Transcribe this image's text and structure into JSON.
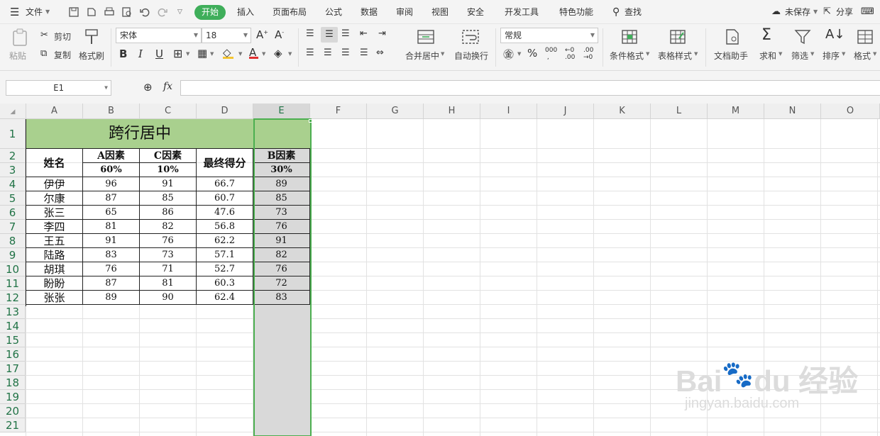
{
  "menubar": {
    "file": "文件",
    "tabs": [
      "开始",
      "插入",
      "页面布局",
      "公式",
      "数据",
      "审阅",
      "视图",
      "安全",
      "开发工具",
      "特色功能"
    ],
    "search": "查找",
    "unsaved": "未保存",
    "share": "分享"
  },
  "ribbon": {
    "paste": "粘贴",
    "cut": "剪切",
    "copy": "复制",
    "format_painter": "格式刷",
    "font_name": "宋体",
    "font_size": "18",
    "bold": "B",
    "italic": "I",
    "underline": "U",
    "merge_center": "合并居中",
    "wrap_text": "自动换行",
    "number_format": "常规",
    "percent": "%",
    "thousands": "000",
    "cond_format": "条件格式",
    "table_style": "表格样式",
    "doc_helper": "文档助手",
    "sum": "求和",
    "filter": "筛选",
    "sort": "排序",
    "format": "格式"
  },
  "formula_bar": {
    "cell_ref": "E1",
    "fx": "fx",
    "value": ""
  },
  "sheet": {
    "columns": [
      "A",
      "B",
      "C",
      "D",
      "E",
      "F",
      "G",
      "H",
      "I",
      "J",
      "K",
      "L",
      "M",
      "N",
      "O"
    ],
    "rows": [
      "1",
      "2",
      "3",
      "4",
      "5",
      "6",
      "7",
      "8",
      "9",
      "10",
      "11",
      "12",
      "13",
      "14",
      "15",
      "16",
      "17",
      "18",
      "19",
      "20",
      "21"
    ],
    "selected_column": "E",
    "title": "跨行居中",
    "header": {
      "name": "姓名",
      "a_factor": "A因素",
      "a_weight": "60%",
      "c_factor": "C因素",
      "c_weight": "10%",
      "final": "最终得分",
      "b_factor": "B因素",
      "b_weight": "30%"
    },
    "data": [
      {
        "name": "伊伊",
        "a": "96",
        "c": "91",
        "final": "66.7",
        "b": "89"
      },
      {
        "name": "尔康",
        "a": "87",
        "c": "85",
        "final": "60.7",
        "b": "85"
      },
      {
        "name": "张三",
        "a": "65",
        "c": "86",
        "final": "47.6",
        "b": "73"
      },
      {
        "name": "李四",
        "a": "81",
        "c": "82",
        "final": "56.8",
        "b": "76"
      },
      {
        "name": "王五",
        "a": "91",
        "c": "76",
        "final": "62.2",
        "b": "91"
      },
      {
        "name": "陆路",
        "a": "83",
        "c": "73",
        "final": "57.1",
        "b": "82"
      },
      {
        "name": "胡琪",
        "a": "76",
        "c": "71",
        "final": "52.7",
        "b": "76"
      },
      {
        "name": "盼盼",
        "a": "87",
        "c": "81",
        "final": "60.3",
        "b": "72"
      },
      {
        "name": "张张",
        "a": "89",
        "c": "90",
        "final": "62.4",
        "b": "83"
      }
    ]
  },
  "watermark": {
    "brand": "Bai",
    "brand2": "du",
    "cn": "经验",
    "url": "jingyan.baidu.com"
  },
  "colors": {
    "accent_green": "#3fae5a",
    "title_fill": "#a9d08e",
    "selection_fill": "#d9d9d9",
    "selection_border": "#4caf50"
  }
}
